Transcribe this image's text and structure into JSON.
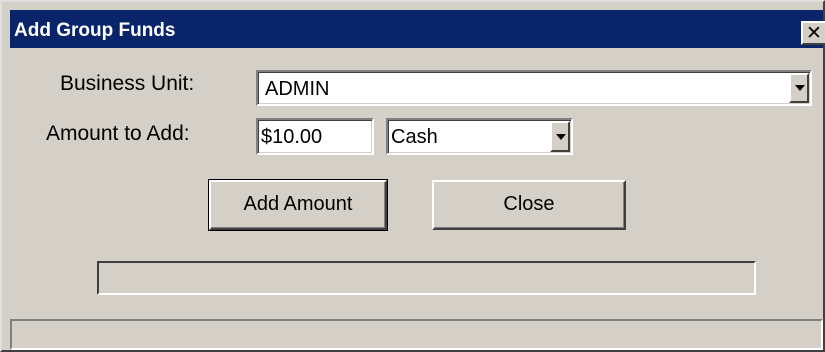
{
  "window": {
    "title": "Add Group Funds",
    "close_label": "✕"
  },
  "form": {
    "business_unit_label": "Business Unit:",
    "business_unit_value": "ADMIN",
    "amount_label": "Amount to Add:",
    "amount_value": "$10.00",
    "payment_type_value": "Cash"
  },
  "buttons": {
    "add_amount_label": "Add Amount",
    "close_label": "Close"
  },
  "progress": {
    "fraction": 0
  },
  "status": {
    "text": ""
  },
  "colors": {
    "titlebar": "#0a246a",
    "face": "#d4d0c8"
  },
  "icons": {
    "close": "close-icon",
    "dropdown": "chevron-down-icon"
  }
}
